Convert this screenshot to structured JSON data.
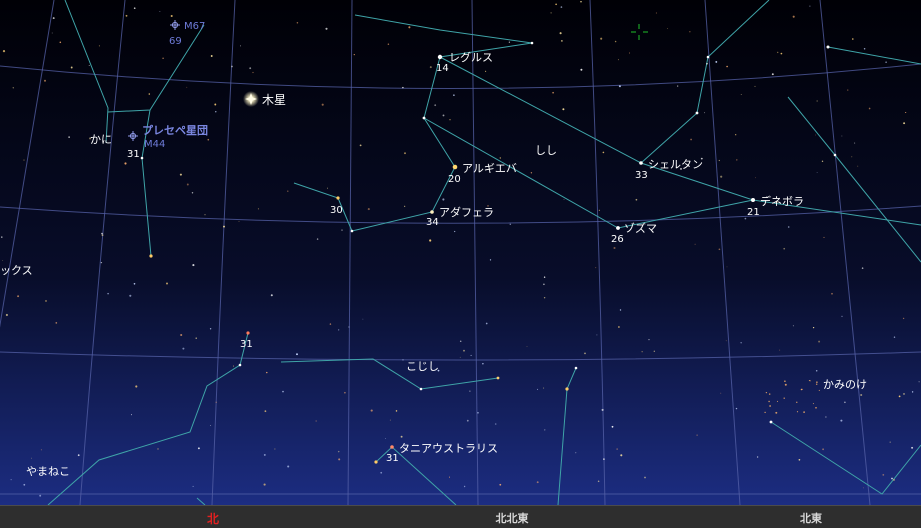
{
  "colors": {
    "sky_top": "#000006",
    "sky_mid": "#080d2a",
    "sky_horizon": "#1c2d82",
    "grid": "#5562a8",
    "constellation_line": "#3fa4a8",
    "label": "#ffffff",
    "deep_sky_label": "#6e7bd8",
    "north_marker": "#e12020",
    "cursor": "#1fbf2a"
  },
  "sky": {
    "planet_label": "木星",
    "constellations": {
      "leo": "しし",
      "cancer": "かに",
      "leo_minor": "こじし",
      "lynx": "やまねこ",
      "lynx_partial": "ックス",
      "coma_berenices": "かみのけ"
    },
    "stars": {
      "regulus": "レグルス",
      "algieba": "アルギエバ",
      "adhafera": "アダフェラ",
      "chertan": "シェルタン",
      "zosma": "ゾズマ",
      "denebola": "デネボラ",
      "tania_australis": "タニアウストラリス"
    },
    "deep_sky": {
      "m67": "M67",
      "praesepe": "プレセペ星団",
      "m44": "M44"
    },
    "flamsteed": {
      "n69": "69",
      "n31_cancer": "31",
      "n14": "14",
      "n20": "20",
      "n30": "30",
      "n34": "34",
      "n33": "33",
      "n26": "26",
      "n21": "21",
      "n31_lmi": "31",
      "n31_uma": "31"
    }
  },
  "compass": {
    "north": "北",
    "north_northeast": "北北東",
    "northeast": "北東"
  }
}
